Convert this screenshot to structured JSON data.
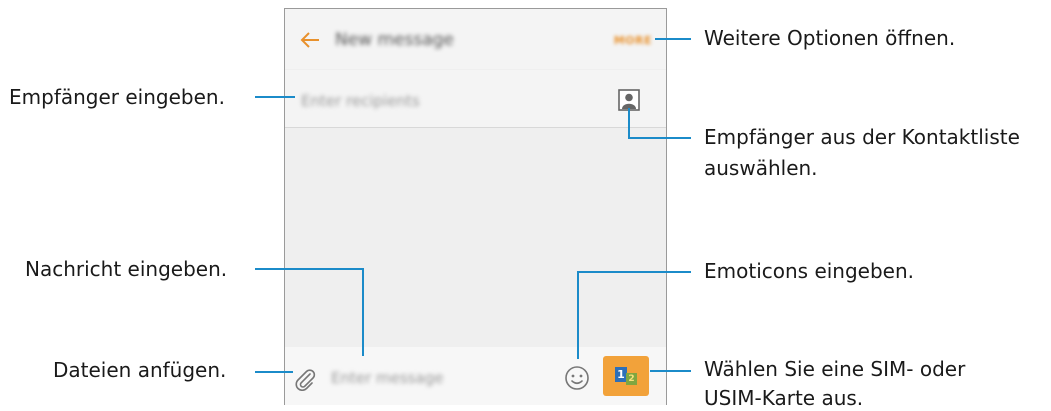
{
  "screen": {
    "title": "New message",
    "more_label": "MORE",
    "recipients_placeholder": "Enter recipients",
    "message_placeholder": "Enter message",
    "sim_labels": [
      "1",
      "2"
    ]
  },
  "callouts": {
    "more_options": "Weitere Optionen öffnen.",
    "enter_recipients": "Empfänger eingeben.",
    "pick_contact_line1": "Empfänger aus der Kontaktliste",
    "pick_contact_line2": "auswählen.",
    "enter_message": "Nachricht eingeben.",
    "emoticons": "Emoticons eingeben.",
    "attach_files": "Dateien anfügen.",
    "sim_line1": "Wählen Sie eine SIM- oder",
    "sim_line2": "USIM-Karte aus."
  },
  "colors": {
    "accent": "#e8912d",
    "callout_line": "#1b8bc9",
    "sim_button": "#f2a23a"
  }
}
